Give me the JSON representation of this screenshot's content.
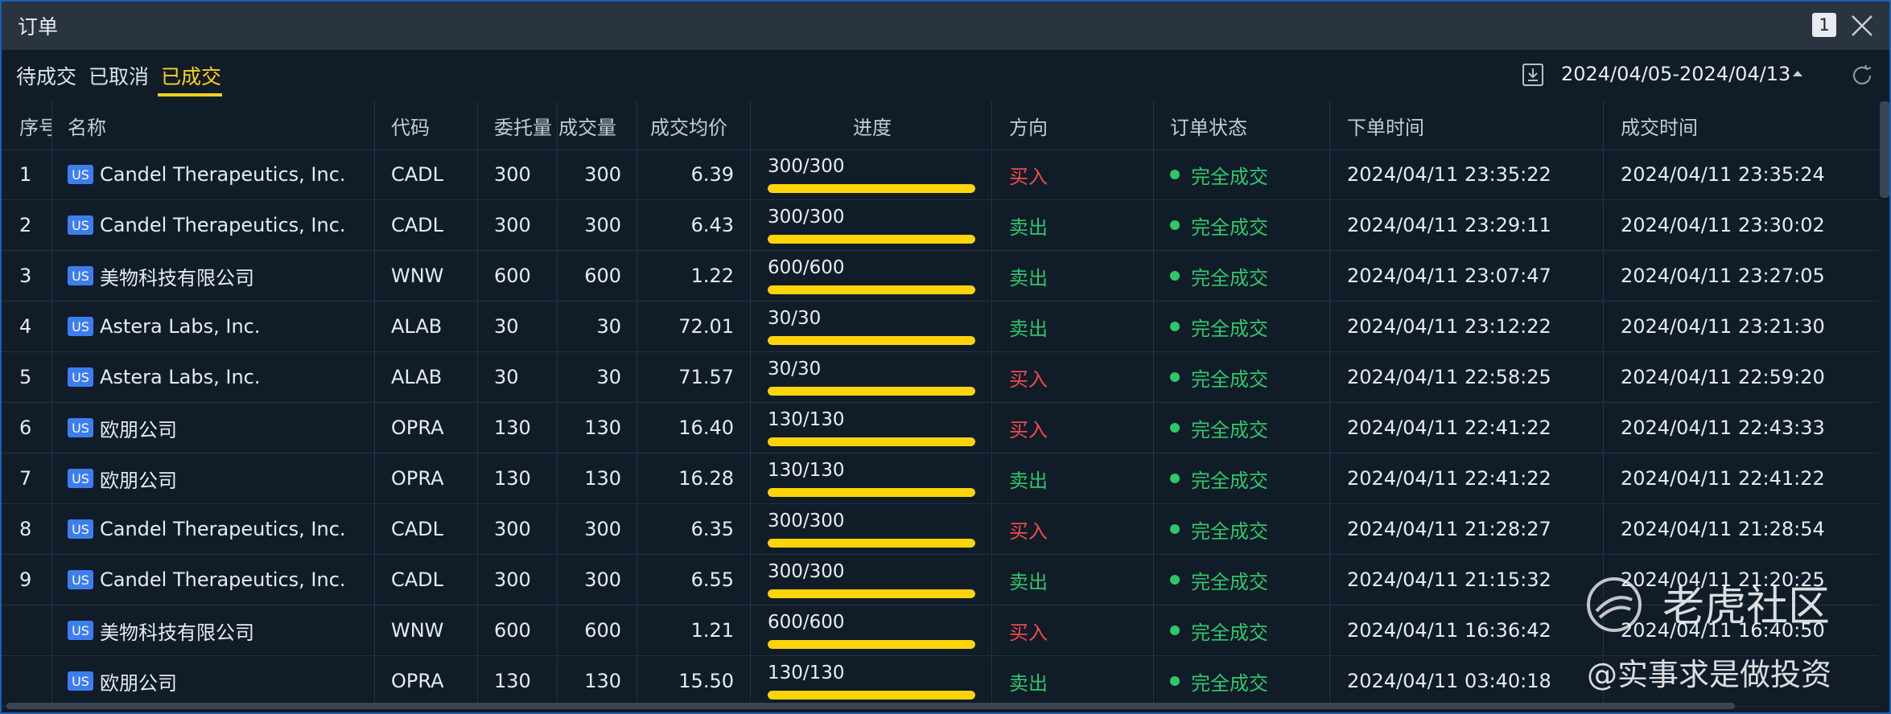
{
  "window": {
    "title": "订单",
    "badge": "1"
  },
  "tabs": [
    {
      "label": "待成交",
      "active": false
    },
    {
      "label": "已取消",
      "active": false
    },
    {
      "label": "已成交",
      "active": true
    }
  ],
  "toolbar": {
    "date_range": "2024/04/05-2024/04/13",
    "export_icon": "export-icon",
    "refresh_icon": "refresh-icon"
  },
  "columns": [
    "序号",
    "名称",
    "代码",
    "委托量",
    "成交量",
    "成交均价",
    "进度",
    "方向",
    "订单状态",
    "下单时间",
    "成交时间"
  ],
  "market_badge": "US",
  "colors": {
    "accent": "#f6d31e",
    "buy": "#ef4b4b",
    "sell": "#2fc76a",
    "progress": "#ffd40a",
    "badge": "#3d7df0"
  },
  "rows": [
    {
      "index": "1",
      "name": "Candel Therapeutics, Inc.",
      "code": "CADL",
      "order_qty": "300",
      "filled_qty": "300",
      "avg_price": "6.39",
      "progress": "300/300",
      "progress_fraction": 1.0,
      "side": "买入",
      "side_type": "buy",
      "status": "完全成交",
      "order_time": "2024/04/11 23:35:22",
      "fill_time": "2024/04/11 23:35:24"
    },
    {
      "index": "2",
      "name": "Candel Therapeutics, Inc.",
      "code": "CADL",
      "order_qty": "300",
      "filled_qty": "300",
      "avg_price": "6.43",
      "progress": "300/300",
      "progress_fraction": 1.0,
      "side": "卖出",
      "side_type": "sell",
      "status": "完全成交",
      "order_time": "2024/04/11 23:29:11",
      "fill_time": "2024/04/11 23:30:02"
    },
    {
      "index": "3",
      "name": "美物科技有限公司",
      "code": "WNW",
      "order_qty": "600",
      "filled_qty": "600",
      "avg_price": "1.22",
      "progress": "600/600",
      "progress_fraction": 1.0,
      "side": "卖出",
      "side_type": "sell",
      "status": "完全成交",
      "order_time": "2024/04/11 23:07:47",
      "fill_time": "2024/04/11 23:27:05"
    },
    {
      "index": "4",
      "name": "Astera Labs, Inc.",
      "code": "ALAB",
      "order_qty": "30",
      "filled_qty": "30",
      "avg_price": "72.01",
      "progress": "30/30",
      "progress_fraction": 1.0,
      "side": "卖出",
      "side_type": "sell",
      "status": "完全成交",
      "order_time": "2024/04/11 23:12:22",
      "fill_time": "2024/04/11 23:21:30"
    },
    {
      "index": "5",
      "name": "Astera Labs, Inc.",
      "code": "ALAB",
      "order_qty": "30",
      "filled_qty": "30",
      "avg_price": "71.57",
      "progress": "30/30",
      "progress_fraction": 1.0,
      "side": "买入",
      "side_type": "buy",
      "status": "完全成交",
      "order_time": "2024/04/11 22:58:25",
      "fill_time": "2024/04/11 22:59:20"
    },
    {
      "index": "6",
      "name": "欧朋公司",
      "code": "OPRA",
      "order_qty": "130",
      "filled_qty": "130",
      "avg_price": "16.40",
      "progress": "130/130",
      "progress_fraction": 1.0,
      "side": "买入",
      "side_type": "buy",
      "status": "完全成交",
      "order_time": "2024/04/11 22:41:22",
      "fill_time": "2024/04/11 22:43:33"
    },
    {
      "index": "7",
      "name": "欧朋公司",
      "code": "OPRA",
      "order_qty": "130",
      "filled_qty": "130",
      "avg_price": "16.28",
      "progress": "130/130",
      "progress_fraction": 1.0,
      "side": "卖出",
      "side_type": "sell",
      "status": "完全成交",
      "order_time": "2024/04/11 22:41:22",
      "fill_time": "2024/04/11 22:41:22"
    },
    {
      "index": "8",
      "name": "Candel Therapeutics, Inc.",
      "code": "CADL",
      "order_qty": "300",
      "filled_qty": "300",
      "avg_price": "6.35",
      "progress": "300/300",
      "progress_fraction": 1.0,
      "side": "买入",
      "side_type": "buy",
      "status": "完全成交",
      "order_time": "2024/04/11 21:28:27",
      "fill_time": "2024/04/11 21:28:54"
    },
    {
      "index": "9",
      "name": "Candel Therapeutics, Inc.",
      "code": "CADL",
      "order_qty": "300",
      "filled_qty": "300",
      "avg_price": "6.55",
      "progress": "300/300",
      "progress_fraction": 1.0,
      "side": "卖出",
      "side_type": "sell",
      "status": "完全成交",
      "order_time": "2024/04/11 21:15:32",
      "fill_time": "2024/04/11 21:20:25"
    },
    {
      "index": "",
      "name": "美物科技有限公司",
      "code": "WNW",
      "order_qty": "600",
      "filled_qty": "600",
      "avg_price": "1.21",
      "progress": "600/600",
      "progress_fraction": 1.0,
      "side": "买入",
      "side_type": "buy",
      "status": "完全成交",
      "order_time": "2024/04/11 16:36:42",
      "fill_time": "2024/04/11 16:40:50"
    },
    {
      "index": "",
      "name": "欧朋公司",
      "code": "OPRA",
      "order_qty": "130",
      "filled_qty": "130",
      "avg_price": "15.50",
      "progress": "130/130",
      "progress_fraction": 1.0,
      "side": "卖出",
      "side_type": "sell",
      "status": "完全成交",
      "order_time": "2024/04/11 03:40:18",
      "fill_time": ""
    }
  ],
  "watermark": {
    "brand": "老虎社区",
    "author": "@实事求是做投资",
    "logo_icon": "tiger-logo-icon"
  }
}
